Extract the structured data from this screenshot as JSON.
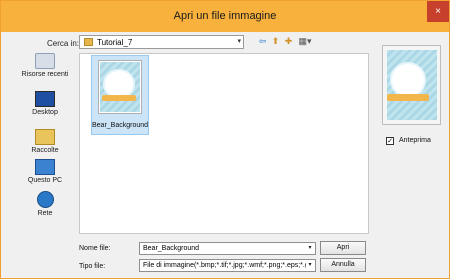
{
  "window": {
    "title": "Apri un file immagine",
    "close_glyph": "×"
  },
  "lookin": {
    "label": "Cerca in:",
    "value": "Tutorial_7",
    "arrow": "▾"
  },
  "toolbar": {
    "back_glyph": "⇦",
    "up_glyph": "⬆",
    "newfolder_glyph": "✚",
    "view_glyph": "▦▾"
  },
  "places": [
    {
      "label": "Risorse recenti",
      "icon": "recent-icon"
    },
    {
      "label": "Desktop",
      "icon": "desktop-icon"
    },
    {
      "label": "Raccolte",
      "icon": "libraries-icon"
    },
    {
      "label": "Questo PC",
      "icon": "pc-icon"
    },
    {
      "label": "Rete",
      "icon": "network-icon"
    }
  ],
  "files": [
    {
      "name": "Bear_Background"
    }
  ],
  "preview": {
    "checkbox_label": "Anteprima",
    "checked": true,
    "check_glyph": "✓"
  },
  "filename": {
    "label": "Nome file:",
    "value": "Bear_Background",
    "arrow": "▾"
  },
  "filetype": {
    "label": "Tipo file:",
    "value": "File di immagine(*.bmp;*.tif;*.jpg;*.wmf;*.png;*.eps;*.gif",
    "arrow": "▾"
  },
  "buttons": {
    "open": "Apri",
    "cancel": "Annulla"
  },
  "colors": {
    "title_bar": "#f7b13c",
    "selection": "#cce4f7",
    "close": "#c7402b"
  }
}
